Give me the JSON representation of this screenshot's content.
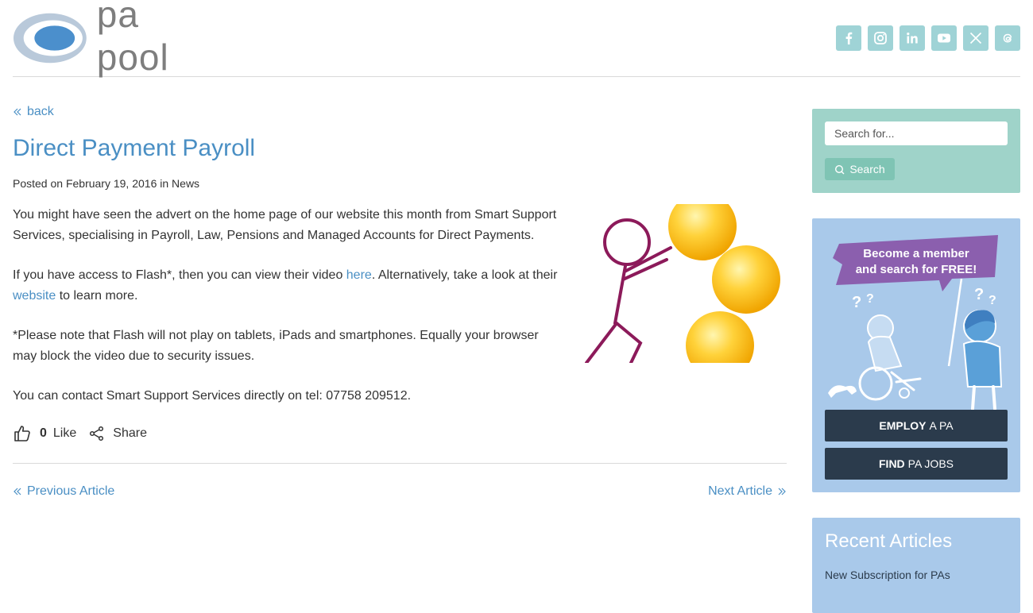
{
  "brand": {
    "logo_text": "pa pool"
  },
  "social": [
    {
      "icon": "facebook-icon"
    },
    {
      "icon": "instagram-icon"
    },
    {
      "icon": "linkedin-icon"
    },
    {
      "icon": "youtube-icon"
    },
    {
      "icon": "x-icon"
    },
    {
      "icon": "threads-icon"
    }
  ],
  "article": {
    "back_label": "back",
    "title": "Direct Payment Payroll",
    "meta_prefix": "Posted on",
    "date": "February 19, 2016",
    "meta_in": "in",
    "category": "News",
    "p1": "You might have seen the advert on the home page of our website this month from Smart Support Services, specialising in Payroll, Law, Pensions and Managed Accounts for Direct Payments.",
    "p2_before": "If you have access to Flash*, then you can view their video ",
    "p2_link1": "here",
    "p2_middle": ". Alternatively, take a look at their ",
    "p2_link2": "website",
    "p2_after": " to learn more.",
    "p3": "*Please note that Flash will not play on tablets, iPads and smartphones. Equally your browser may block the video due to security issues.",
    "p4": "You can contact Smart Support Services directly on tel: 07758 209512.",
    "like_count": "0",
    "like_label": "Like",
    "share_label": "Share",
    "prev_label": "Previous Article",
    "next_label": "Next Article"
  },
  "sidebar": {
    "search_placeholder": "Search for...",
    "search_button": "Search",
    "promo_line1": "Become a member",
    "promo_line2": "and search for FREE!",
    "employ_bold": "EMPLOY",
    "employ_rest": "A PA",
    "find_bold": "FIND",
    "find_rest": "PA JOBS",
    "recent_title": "Recent Articles",
    "recent_item": "New Subscription for PAs"
  },
  "colors": {
    "link": "#4a8fc4",
    "teal": "#9fd3c9",
    "promo_bg": "#a9c9ea",
    "dark_button": "#2b3b4c",
    "purple": "#8b5fae"
  }
}
